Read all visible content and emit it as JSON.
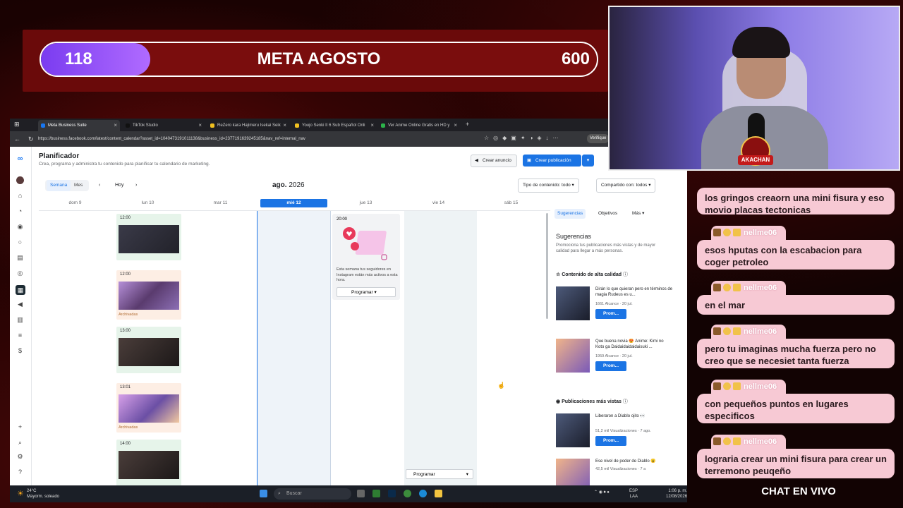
{
  "goal": {
    "current": "118",
    "title": "META AGOSTO",
    "target": "600",
    "progress": 0.197
  },
  "browser": {
    "tabs": [
      {
        "label": "Meta Business Suite",
        "active": true
      },
      {
        "label": "TikTok Studio"
      },
      {
        "label": "ReZero kara Hajimeru Isekai Seik"
      },
      {
        "label": "Youjo Senki II 6 Sub Español Onli"
      },
      {
        "label": "Ver Anime Online Gratis en HD y"
      }
    ],
    "url": "https://business.facebook.com/latest/content_calendar?asset_id=1040473191011138&business_id=2377191639245185&nav_ref=internal_nav",
    "verify_label": "Verifique"
  },
  "page": {
    "title": "Planificador",
    "subtitle": "Crea, programa y administra tu contenido para planificar tu calendario de marketing.",
    "btn_anuncio": "Crear anuncio",
    "btn_publicacion": "Crear publicación",
    "view_week": "Semana",
    "view_month": "Mes",
    "today": "Hoy",
    "month": "ago.",
    "year": "2026",
    "filter_type": "Tipo de contenido: todo",
    "filter_shared": "Compartido con: todos",
    "days": [
      "dom 9",
      "lun 10",
      "mar 11",
      "mié 12",
      "jue 13",
      "vie 14",
      "sáb 15"
    ],
    "posts": [
      {
        "time": "12:00",
        "status": ""
      },
      {
        "time": "12:00",
        "status": "Archivadas"
      },
      {
        "time": "13:00",
        "status": ""
      },
      {
        "time": "13:01",
        "status": "Archivadas"
      },
      {
        "time": "14:00",
        "status": ""
      }
    ],
    "ig_card": {
      "time": "20:00",
      "text": "Esta semana tus seguidores en Instagram están más activos a esta hora.",
      "button": "Programar"
    },
    "fri_button": "Programar"
  },
  "panel": {
    "tab_suggestions": "Sugerencias",
    "tab_goals": "Objetivos",
    "tab_more": "Más",
    "heading": "Sugerencias",
    "sub": "Promociona tus publicaciones más vistas y de mayor calidad para llegar a más personas.",
    "section1": "Contenido de alta calidad",
    "section2": "Publicaciones más vistas",
    "items": [
      {
        "title": "Dirán lo que quieran pero en términos de magia Rudeus es u...",
        "meta": "1661 Alcance · 20 jul.",
        "button": "Prom..."
      },
      {
        "title": "Que buena novia 😍 Anime: Kimi no Koto ga Daidaidaidaidaisuki ...",
        "meta": "1959 Alcance · 20 jul.",
        "button": "Prom..."
      },
      {
        "title": "Liberaron a Diablo ojito 👀",
        "meta": "51,2 mil Visualizaciones · 7 ago.",
        "button": "Prom..."
      },
      {
        "title": "Ese nivel de poder de Diablo 😮",
        "meta": "42,5 mil Visualizaciones · 7 a",
        "button": ""
      }
    ]
  },
  "taskbar": {
    "temp": "24°C",
    "weather": "Mayorm. soleado",
    "search": "Buscar",
    "lang": "ESP",
    "lang2": "LAA",
    "time": "1:06 p. m.",
    "date": "12/08/2026"
  },
  "webcam": {
    "badge": "AKACHAN"
  },
  "chat": {
    "title": "CHAT EN VIVO",
    "messages": [
      {
        "user": "",
        "text": "los gringos creaorn una mini fisura y eso movio placas tectonicas"
      },
      {
        "user": "nellme06",
        "text": "esos hputas con la escabacion para coger petroleo"
      },
      {
        "user": "nellme06",
        "text": "en el mar"
      },
      {
        "user": "nellme06",
        "text": "pero tu imaginas mucha fuerza pero no creo que se necesiet tanta fuerza"
      },
      {
        "user": "nellme06",
        "text": "con pequeños puntos en lugares especificos"
      },
      {
        "user": "nellme06",
        "text": "lograria crear un mini fisura para crear un terremono peuqeño"
      }
    ]
  },
  "colors": {
    "accent": "#1b74e4",
    "chat_bubble": "#f7c9d4",
    "goal_fill": "#9b55f5"
  }
}
